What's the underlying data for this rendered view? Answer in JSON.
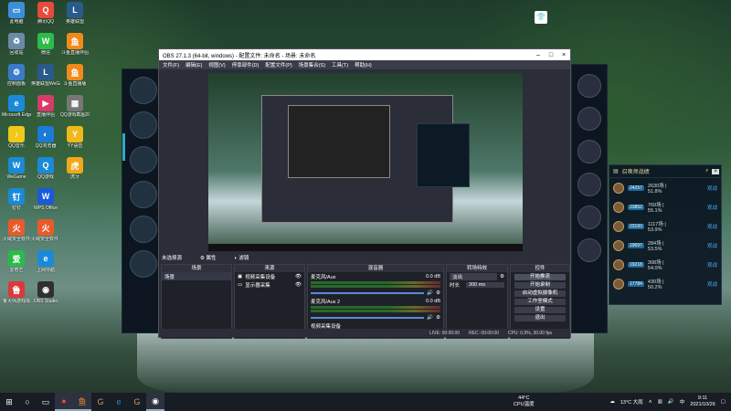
{
  "desktop": {
    "icons": [
      {
        "label": "此电脑",
        "icon": "computer-icon",
        "color": "#3a8fd8",
        "glyph": "▭"
      },
      {
        "label": "腾讯QQ",
        "icon": "qq-icon",
        "color": "#e64a3a",
        "glyph": "Q"
      },
      {
        "label": "英雄联盟",
        "icon": "league-icon",
        "color": "#2a5a8a",
        "glyph": "L"
      },
      {
        "label": "回收站",
        "icon": "recycle-bin-icon",
        "color": "#6a8aa8",
        "glyph": "♻"
      },
      {
        "label": "微信",
        "icon": "wechat-icon",
        "color": "#2dbb4a",
        "glyph": "W"
      },
      {
        "label": "斗鱼直播伴侣",
        "icon": "douyu-icon",
        "color": "#f08a1a",
        "glyph": "鱼"
      },
      {
        "label": "控制面板",
        "icon": "control-panel-icon",
        "color": "#3a7ac8",
        "glyph": "⚙"
      },
      {
        "label": "英雄联盟WeGame版",
        "icon": "wegame-lol-icon",
        "color": "#2a5a8a",
        "glyph": "L"
      },
      {
        "label": "斗鱼直播版",
        "icon": "douyu-icon",
        "color": "#f08a1a",
        "glyph": "鱼"
      },
      {
        "label": "Microsoft Edge",
        "icon": "edge-icon",
        "color": "#1a8ad8",
        "glyph": "e"
      },
      {
        "label": "直播伴侣",
        "icon": "live-companion-icon",
        "color": "#d83a6a",
        "glyph": "▶"
      },
      {
        "label": "QQ游戏截图2021100...",
        "icon": "image-file-icon",
        "color": "#777",
        "glyph": "▦"
      },
      {
        "label": "QQ音乐",
        "icon": "qq-music-icon",
        "color": "#f0c81a",
        "glyph": "♪"
      },
      {
        "label": "QQ浏览器",
        "icon": "qq-browser-icon",
        "color": "#1a7ad8",
        "glyph": "◐"
      },
      {
        "label": "YY语音",
        "icon": "yy-icon",
        "color": "#f0b81a",
        "glyph": "Y"
      },
      {
        "label": "WeGame",
        "icon": "wegame-icon",
        "color": "#1a8ad8",
        "glyph": "W"
      },
      {
        "label": "QQ游戏",
        "icon": "qq-game-icon",
        "color": "#1a8ad8",
        "glyph": "Q"
      },
      {
        "label": "虎牙",
        "icon": "huya-icon",
        "color": "#f0a81a",
        "glyph": "虎"
      },
      {
        "label": "钉钉",
        "icon": "dingtalk-icon",
        "color": "#1a8ad8",
        "glyph": "钉"
      },
      {
        "label": "WPS Office",
        "icon": "wps-icon",
        "color": "#1a5ad8",
        "glyph": "W"
      },
      {
        "label": "",
        "icon": "",
        "color": "transparent",
        "glyph": ""
      },
      {
        "label": "火绒安全软件",
        "icon": "huorong-icon",
        "color": "#e85a2a",
        "glyph": "火"
      },
      {
        "label": "火绒安全软件 弹窗",
        "icon": "huorong-icon",
        "color": "#e85a2a",
        "glyph": "火"
      },
      {
        "label": "",
        "icon": "",
        "color": "transparent",
        "glyph": ""
      },
      {
        "label": "爱奇艺",
        "icon": "iqiyi-icon",
        "color": "#2aba4a",
        "glyph": "爱"
      },
      {
        "label": "上网导航",
        "icon": "browser-icon",
        "color": "#1a8ad8",
        "glyph": "e"
      },
      {
        "label": "",
        "icon": "",
        "color": "transparent",
        "glyph": ""
      },
      {
        "label": "鲁大师游戏库",
        "icon": "ludashi-icon",
        "color": "#d83a3a",
        "glyph": "鲁"
      },
      {
        "label": "OBS Studio",
        "icon": "obs-icon",
        "color": "#303030",
        "glyph": "◉"
      }
    ]
  },
  "obs": {
    "title": "OBS 27.1.3 (64-bit, windows) - 配置文件: 未命名 - 场景: 未命名",
    "menu": [
      "文件(F)",
      "编辑(E)",
      "视图(V)",
      "停靠部件(D)",
      "配置文件(P)",
      "场景集合(S)",
      "工具(T)",
      "帮助(H)"
    ],
    "scene_bar": {
      "label": "未选择源",
      "props": "属性",
      "filters": "滤镜"
    },
    "docks": {
      "scenes": {
        "title": "场景",
        "items": [
          "场景"
        ]
      },
      "sources": {
        "title": "来源",
        "items": [
          "视频采集设备",
          "显示器采集"
        ]
      },
      "mixer": {
        "title": "混音器",
        "channels": [
          {
            "name": "麦克风/Aux",
            "db": "0.0 dB"
          },
          {
            "name": "麦克风/Aux 2",
            "db": "0.0 dB"
          },
          {
            "name": "视频采集设备",
            "db": ""
          }
        ]
      },
      "transitions": {
        "title": "转场特效",
        "type": "淡出",
        "duration_label": "时长",
        "duration": "300 ms"
      },
      "controls": {
        "title": "控件",
        "buttons": [
          "开始推流",
          "开始录制",
          "启动虚拟摄像机",
          "工作室模式",
          "设置",
          "退出"
        ]
      }
    },
    "status": [
      "LIVE: 00:00:00",
      "REC: 00:00:00",
      "CPU: 0.9%, 30.00 fps"
    ]
  },
  "overlay_panel": {
    "title": "召唤师战绩",
    "rows": [
      {
        "score": "24257",
        "stats": "2630场 | 51.8%",
        "action": "观战"
      },
      {
        "score": "23852",
        "stats": "769场 | 55.1%",
        "action": "观战"
      },
      {
        "score": "23193",
        "stats": "1117场 | 53.9%",
        "action": "观战"
      },
      {
        "score": "19697",
        "stats": "284场 | 53.5%",
        "action": "观战"
      },
      {
        "score": "19218",
        "stats": "308场 | 54.0%",
        "action": "观战"
      },
      {
        "score": "17784",
        "stats": "430场 | 50.2%",
        "action": "观战"
      }
    ]
  },
  "taskbar": {
    "cpu_temp": "44°C",
    "cpu_label": "CPU温度",
    "weather": "13°C 大雨",
    "lang": "中",
    "time": "9:11",
    "date": "2021/10/26"
  }
}
